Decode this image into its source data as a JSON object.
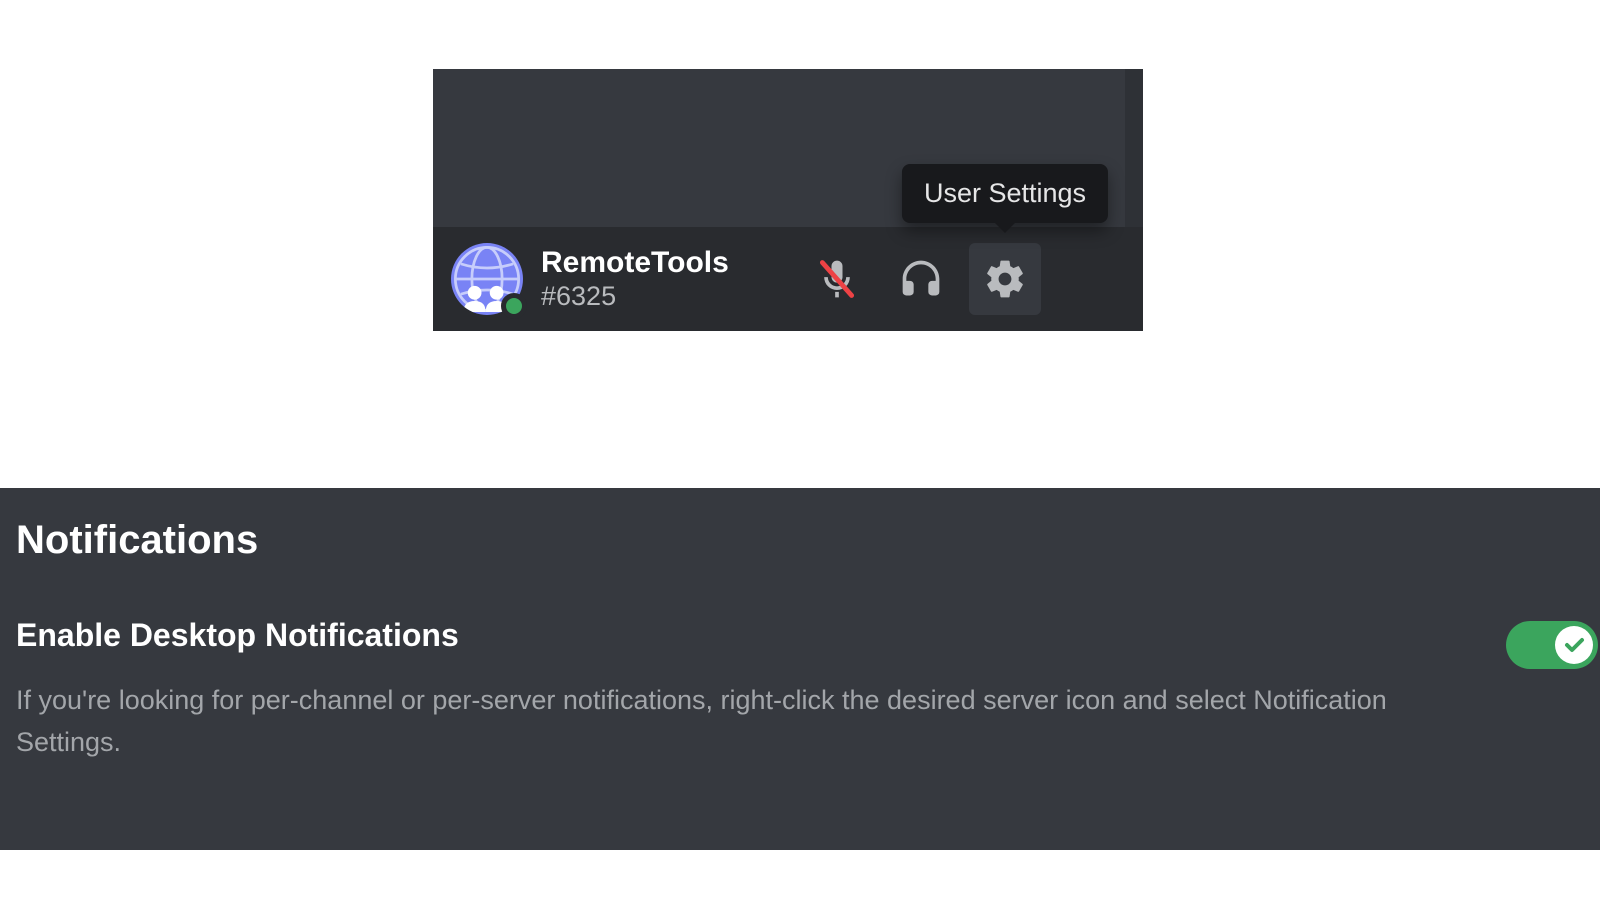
{
  "userPanel": {
    "tooltip": "User Settings",
    "username": "RemoteTools",
    "tag": "#6325",
    "status": "online"
  },
  "settings": {
    "sectionTitle": "Notifications",
    "desktopToggle": {
      "label": "Enable Desktop Notifications",
      "description": "If you're looking for per-channel or per-server notifications, right-click the desired server icon and select Notification Settings.",
      "enabled": true
    }
  },
  "colors": {
    "panelBg": "#36393f",
    "barBg": "#292b2f",
    "accentGreen": "#3ba55d",
    "textPrimary": "#ffffff",
    "textMuted": "#a3a6aa"
  }
}
